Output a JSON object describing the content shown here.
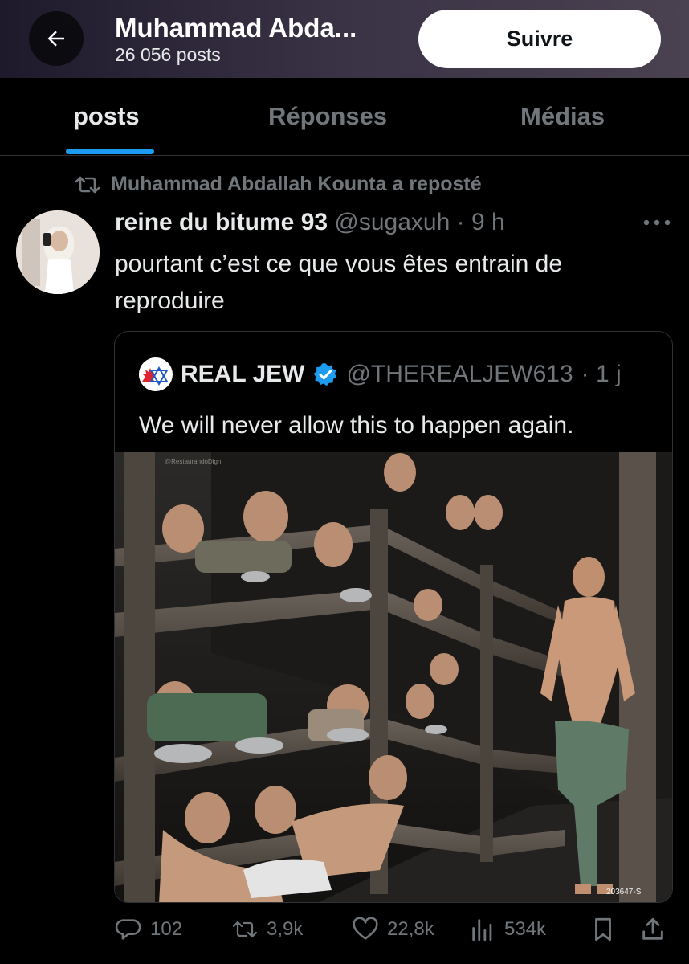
{
  "header": {
    "display_name": "Muhammad Abda...",
    "post_count": "26 056 posts",
    "follow_label": "Suivre",
    "back_icon": "arrow-left-icon"
  },
  "tabs": [
    {
      "label": "posts",
      "active": true
    },
    {
      "label": "Réponses",
      "active": false
    },
    {
      "label": "Médias",
      "active": false
    }
  ],
  "repost": {
    "text": "Muhammad Abdallah Kounta a reposté",
    "icon": "repost-icon"
  },
  "post": {
    "author": "reine du bitume 93",
    "handle": "@sugaxuh",
    "time": "· 9 h",
    "text": "pourtant c’est ce que vous êtes entrain de reproduire",
    "more_icon": "more-horizontal-icon"
  },
  "quote": {
    "author": "REAL JEW",
    "verified": true,
    "handle": "@THEREALJEW613",
    "time": "· 1 j",
    "text": "We will never allow this to happen again.",
    "image_watermark": "@RestaurandoDign",
    "image_caption": "203647-S"
  },
  "actions": {
    "replies": "102",
    "reposts": "3,9k",
    "likes": "22,8k",
    "views": "534k",
    "icons": [
      "reply-icon",
      "repost-icon",
      "like-icon",
      "views-icon",
      "bookmark-icon",
      "share-icon"
    ]
  },
  "colors": {
    "accent": "#1d9bf0",
    "muted_text": "#71767b",
    "primary_text": "#e7e9ea",
    "background": "#000000",
    "divider": "#2f3336"
  }
}
